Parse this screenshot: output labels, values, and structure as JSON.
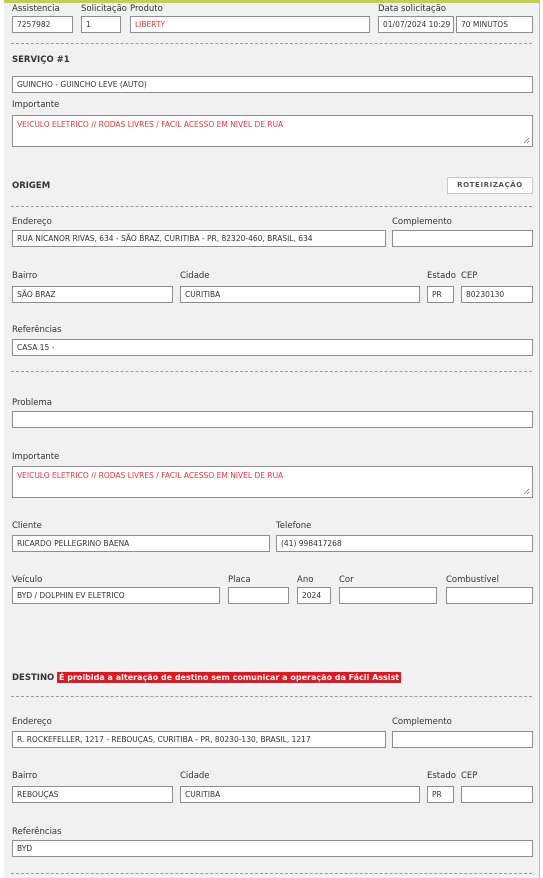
{
  "header": {
    "labels": {
      "assistencia": "Assistencia",
      "solicitacao": "Solicitação",
      "produto": "Produto",
      "data_solicitacao": "Data solicitação"
    },
    "values": {
      "assistencia": "7257982",
      "solicitacao": "1",
      "produto": "LIBERTY",
      "data": "01/07/2024 10:29",
      "tempo": "70 MINUTOS"
    }
  },
  "servico": {
    "title": "SERVIÇO #1",
    "tipo": "GUINCHO - GUINCHO LEVE (AUTO)",
    "importante_label": "Importante",
    "importante": "VEICULO ELETRICO // RODAS LIVRES / FACIL ACESSO EM NIVEL DE RUA"
  },
  "origem": {
    "title": "ORIGEM",
    "button": "ROTEIRIZAÇÃO",
    "labels": {
      "endereco": "Endereço",
      "complemento": "Complemento",
      "bairro": "Bairro",
      "cidade": "Cidade",
      "estado": "Estado",
      "cep": "CEP",
      "referencias": "Referências"
    },
    "endereco": "RUA NICANOR RIVAS, 634 - SÃO BRAZ, CURITIBA - PR, 82320-460, BRASIL, 634",
    "complemento": "",
    "bairro": "SÃO BRAZ",
    "cidade": "CURITIBA",
    "estado": "PR",
    "cep": "80230130",
    "referencias": "CASA 15 -"
  },
  "detalhes": {
    "labels": {
      "problema": "Problema",
      "importante": "Importante",
      "cliente": "Cliente",
      "telefone": "Telefone",
      "veiculo": "Veículo",
      "placa": "Placa",
      "ano": "Ano",
      "cor": "Cor",
      "combustivel": "Combustível"
    },
    "problema": "",
    "importante": "VEICULO ELETRICO // RODAS LIVRES / FACIL ACESSO EM NIVEL DE RUA",
    "cliente": "RICARDO PELLEGRINO BAENA",
    "telefone": "(41) 998417268",
    "veiculo": "BYD / DOLPHIN EV ELETRICO",
    "placa": "",
    "ano": "2024",
    "cor": "",
    "combustivel": ""
  },
  "destino": {
    "title": "DESTINO",
    "warning": "É proibida a alteração de destino sem comunicar a operação da Fácil Assist",
    "labels": {
      "endereco": "Endereço",
      "complemento": "Complemento",
      "bairro": "Bairro",
      "cidade": "Cidade",
      "estado": "Estado",
      "cep": "CEP",
      "referencias": "Referências"
    },
    "endereco": "R. ROCKEFELLER, 1217 - REBOUÇAS, CURITIBA - PR, 80230-130, BRASIL, 1217",
    "complemento": "",
    "bairro": "REBOUÇAS",
    "cidade": "CURITIBA",
    "estado": "PR",
    "cep": "",
    "referencias": "BYD"
  },
  "colors": {
    "accent_top": "#c5d13f",
    "warning_bg": "#e8141e",
    "red_text": "#e53a3a"
  }
}
